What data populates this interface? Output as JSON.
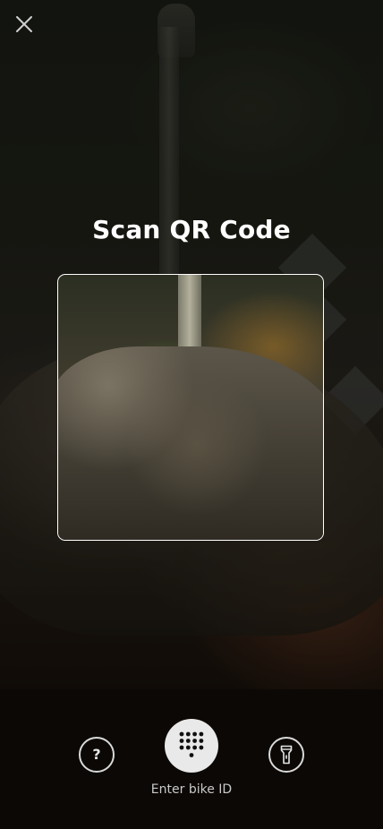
{
  "header": {
    "title": "Scan QR Code",
    "close_icon": "close-icon"
  },
  "scanner": {
    "frame_icon": "qr-scan-frame"
  },
  "controls": {
    "help": {
      "glyph": "?",
      "icon": "help-icon"
    },
    "keypad": {
      "icon": "keypad-icon",
      "label": "Enter bike ID"
    },
    "torch": {
      "icon": "flashlight-icon"
    }
  },
  "colors": {
    "background": "#0b0805",
    "frame_border": "#ffffff",
    "keypad_button": "#e9e9e9",
    "text": "#ffffff"
  }
}
